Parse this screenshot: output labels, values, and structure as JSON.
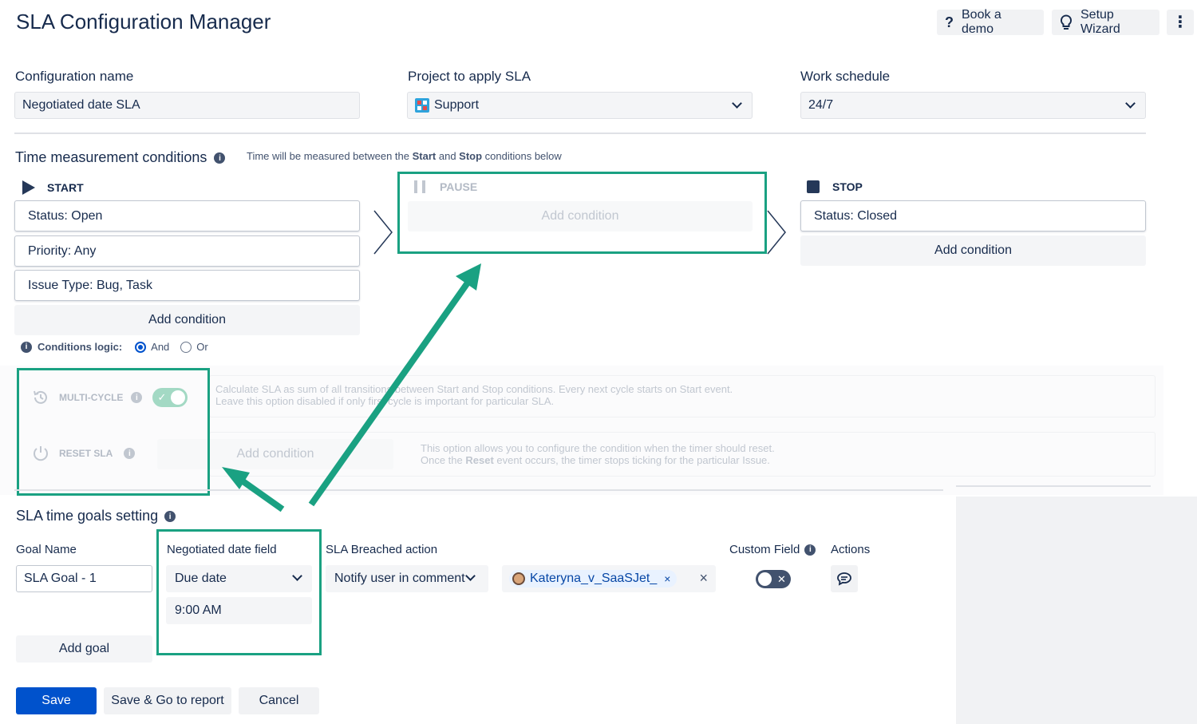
{
  "header": {
    "title": "SLA Configuration Manager",
    "book_demo": "Book a demo",
    "setup_wizard": "Setup Wizard"
  },
  "config": {
    "name_label": "Configuration name",
    "name_value": "Negotiated date SLA",
    "project_label": "Project to apply SLA",
    "project_value": "Support",
    "schedule_label": "Work schedule",
    "schedule_value": "24/7"
  },
  "time_conditions": {
    "title": "Time measurement conditions",
    "hint_pre": "Time will be measured between the ",
    "hint_start": "Start",
    "hint_mid": " and ",
    "hint_stop": "Stop",
    "hint_post": " conditions below",
    "start_label": "START",
    "start_conditions": [
      "Status: Open",
      "Priority: Any",
      "Issue Type: Bug, Task"
    ],
    "pause_label": "PAUSE",
    "stop_label": "STOP",
    "stop_conditions": [
      "Status: Closed"
    ],
    "add_condition": "Add condition",
    "logic_label": "Conditions logic:",
    "logic_and": "And",
    "logic_or": "Or"
  },
  "options": {
    "multicycle_label": "MULTI-CYCLE",
    "multicycle_desc_1": "Calculate SLA as sum of all transitions between Start and Stop conditions. Every next cycle starts on Start event.",
    "multicycle_desc_2": "Leave this option disabled if only first cycle is important for particular SLA.",
    "reset_label": "RESET SLA",
    "reset_add": "Add condition",
    "reset_desc_1": "This option allows you to configure the condition when the timer should reset.",
    "reset_desc_2_pre": "Once the ",
    "reset_desc_2_bold": "Reset",
    "reset_desc_2_post": " event occurs, the timer stops ticking for the particular Issue."
  },
  "goals": {
    "title": "SLA time goals setting",
    "col_goal_name": "Goal Name",
    "col_negotiated": "Negotiated date field",
    "col_breached": "SLA Breached action",
    "col_custom": "Custom Field",
    "col_actions": "Actions",
    "goal_name_value": "SLA Goal - 1",
    "negotiated_field": "Due date",
    "negotiated_time": "9:00 AM",
    "breached_action": "Notify user in comment",
    "user_tag": "Kateryna_v_SaaSJet_",
    "add_goal": "Add goal"
  },
  "footer": {
    "save": "Save",
    "save_report": "Save & Go to report",
    "cancel": "Cancel"
  },
  "colors": {
    "accent": "#1aa182",
    "primary": "#0052cc"
  }
}
